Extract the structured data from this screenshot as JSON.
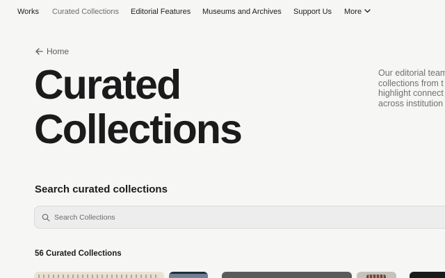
{
  "nav": {
    "items": [
      {
        "label": "Works"
      },
      {
        "label": "Curated Collections"
      },
      {
        "label": "Editorial Features"
      },
      {
        "label": "Museums and Archives"
      },
      {
        "label": "Support Us"
      },
      {
        "label": "More"
      }
    ],
    "active_item": "Curated Collections",
    "more_icon": "chevron-down-icon"
  },
  "breadcrumb": {
    "icon": "arrow-left-icon",
    "label": "Home"
  },
  "hero": {
    "title_lines": [
      "Curated",
      "Collections"
    ],
    "intro_lines": [
      "Our editorial team",
      "collections from t",
      "highlight connect",
      "across institution"
    ]
  },
  "search": {
    "heading": "Search curated collections",
    "placeholder": "Search Collections",
    "value": "",
    "icon": "search-icon"
  },
  "results": {
    "count_label": "56 Curated Collections"
  },
  "colors": {
    "background": "#f6f6f5",
    "text": "#1c1c1c",
    "muted_text": "#707070",
    "search_background": "#ecedec"
  }
}
